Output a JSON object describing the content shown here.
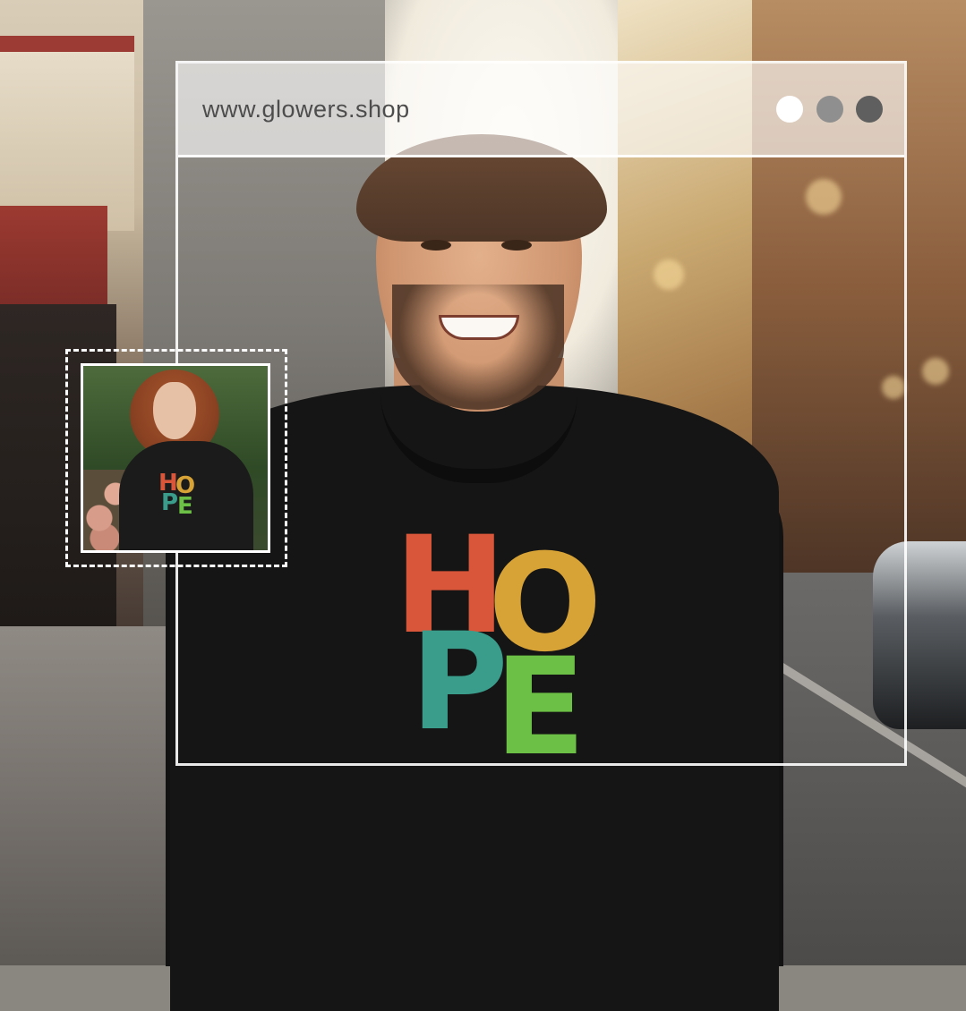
{
  "browser": {
    "url": "www.glowers.shop",
    "window_dots": [
      "white",
      "gray",
      "dark-gray"
    ]
  },
  "product": {
    "print_letters": [
      "H",
      "O",
      "P",
      "E"
    ],
    "print_colors": [
      "#d9563a",
      "#d7a236",
      "#3a9d8c",
      "#6cc046"
    ],
    "garment_color": "#151515"
  },
  "thumbnail": {
    "print_letters": [
      "H",
      "O",
      "P",
      "E"
    ]
  }
}
